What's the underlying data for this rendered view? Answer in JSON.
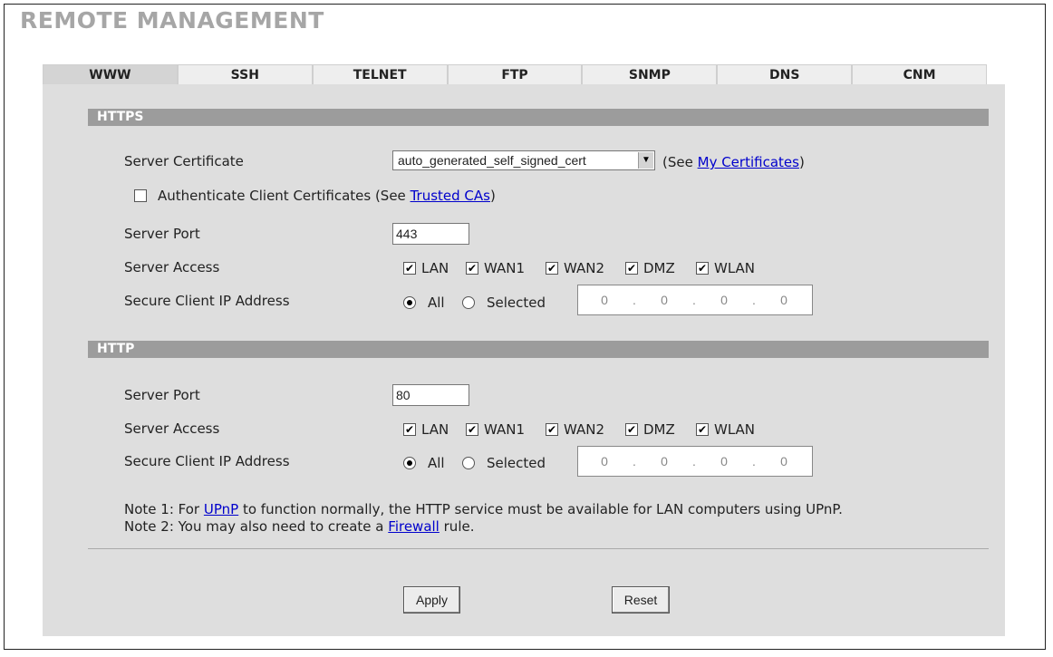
{
  "page": {
    "title": "REMOTE MANAGEMENT"
  },
  "tabs": [
    {
      "label": "WWW",
      "active": true
    },
    {
      "label": "SSH",
      "active": false
    },
    {
      "label": "TELNET",
      "active": false
    },
    {
      "label": "FTP",
      "active": false
    },
    {
      "label": "SNMP",
      "active": false
    },
    {
      "label": "DNS",
      "active": false
    },
    {
      "label": "CNM",
      "active": false
    }
  ],
  "https": {
    "header": "HTTPS",
    "server_certificate_label": "Server Certificate",
    "server_certificate_value": "auto_generated_self_signed_cert",
    "see_prefix": "(See",
    "see_link": "My Certificates",
    "see_suffix": ")",
    "auth_client_label": "Authenticate Client Certificates (See",
    "auth_client_link": "Trusted CAs",
    "auth_client_suffix": ")",
    "auth_client_checked": false,
    "server_port_label": "Server Port",
    "server_port_value": "443",
    "server_access_label": "Server Access",
    "access": [
      {
        "label": "LAN",
        "checked": true
      },
      {
        "label": "WAN1",
        "checked": true
      },
      {
        "label": "WAN2",
        "checked": true
      },
      {
        "label": "DMZ",
        "checked": true
      },
      {
        "label": "WLAN",
        "checked": true
      }
    ],
    "secure_ip_label": "Secure Client IP Address",
    "radio_all": "All",
    "radio_selected": "Selected",
    "ip": [
      "0",
      "0",
      "0",
      "0"
    ]
  },
  "http": {
    "header": "HTTP",
    "server_port_label": "Server Port",
    "server_port_value": "80",
    "server_access_label": "Server Access",
    "access": [
      {
        "label": "LAN",
        "checked": true
      },
      {
        "label": "WAN1",
        "checked": true
      },
      {
        "label": "WAN2",
        "checked": true
      },
      {
        "label": "DMZ",
        "checked": true
      },
      {
        "label": "WLAN",
        "checked": true
      }
    ],
    "secure_ip_label": "Secure Client IP Address",
    "radio_all": "All",
    "radio_selected": "Selected",
    "ip": [
      "0",
      "0",
      "0",
      "0"
    ]
  },
  "notes": {
    "note1_prefix": "Note 1: For",
    "note1_link": "UPnP",
    "note1_suffix": "to function normally, the HTTP service must be available for LAN computers using UPnP.",
    "note2_prefix": "Note 2: You may also need to create a",
    "note2_link": "Firewall",
    "note2_suffix": "rule."
  },
  "buttons": {
    "apply": "Apply",
    "reset": "Reset"
  },
  "icons": {
    "checkmark": "✔",
    "dropdown_arrow": "▼"
  }
}
